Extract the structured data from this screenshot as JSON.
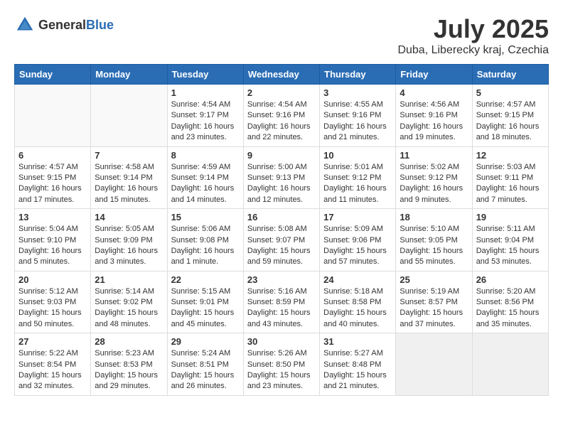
{
  "header": {
    "logo_general": "General",
    "logo_blue": "Blue",
    "title": "July 2025",
    "location": "Duba, Liberecky kraj, Czechia"
  },
  "calendar": {
    "days_of_week": [
      "Sunday",
      "Monday",
      "Tuesday",
      "Wednesday",
      "Thursday",
      "Friday",
      "Saturday"
    ],
    "weeks": [
      [
        {
          "day": "",
          "info": ""
        },
        {
          "day": "",
          "info": ""
        },
        {
          "day": "1",
          "info": "Sunrise: 4:54 AM\nSunset: 9:17 PM\nDaylight: 16 hours\nand 23 minutes."
        },
        {
          "day": "2",
          "info": "Sunrise: 4:54 AM\nSunset: 9:16 PM\nDaylight: 16 hours\nand 22 minutes."
        },
        {
          "day": "3",
          "info": "Sunrise: 4:55 AM\nSunset: 9:16 PM\nDaylight: 16 hours\nand 21 minutes."
        },
        {
          "day": "4",
          "info": "Sunrise: 4:56 AM\nSunset: 9:16 PM\nDaylight: 16 hours\nand 19 minutes."
        },
        {
          "day": "5",
          "info": "Sunrise: 4:57 AM\nSunset: 9:15 PM\nDaylight: 16 hours\nand 18 minutes."
        }
      ],
      [
        {
          "day": "6",
          "info": "Sunrise: 4:57 AM\nSunset: 9:15 PM\nDaylight: 16 hours\nand 17 minutes."
        },
        {
          "day": "7",
          "info": "Sunrise: 4:58 AM\nSunset: 9:14 PM\nDaylight: 16 hours\nand 15 minutes."
        },
        {
          "day": "8",
          "info": "Sunrise: 4:59 AM\nSunset: 9:14 PM\nDaylight: 16 hours\nand 14 minutes."
        },
        {
          "day": "9",
          "info": "Sunrise: 5:00 AM\nSunset: 9:13 PM\nDaylight: 16 hours\nand 12 minutes."
        },
        {
          "day": "10",
          "info": "Sunrise: 5:01 AM\nSunset: 9:12 PM\nDaylight: 16 hours\nand 11 minutes."
        },
        {
          "day": "11",
          "info": "Sunrise: 5:02 AM\nSunset: 9:12 PM\nDaylight: 16 hours\nand 9 minutes."
        },
        {
          "day": "12",
          "info": "Sunrise: 5:03 AM\nSunset: 9:11 PM\nDaylight: 16 hours\nand 7 minutes."
        }
      ],
      [
        {
          "day": "13",
          "info": "Sunrise: 5:04 AM\nSunset: 9:10 PM\nDaylight: 16 hours\nand 5 minutes."
        },
        {
          "day": "14",
          "info": "Sunrise: 5:05 AM\nSunset: 9:09 PM\nDaylight: 16 hours\nand 3 minutes."
        },
        {
          "day": "15",
          "info": "Sunrise: 5:06 AM\nSunset: 9:08 PM\nDaylight: 16 hours\nand 1 minute."
        },
        {
          "day": "16",
          "info": "Sunrise: 5:08 AM\nSunset: 9:07 PM\nDaylight: 15 hours\nand 59 minutes."
        },
        {
          "day": "17",
          "info": "Sunrise: 5:09 AM\nSunset: 9:06 PM\nDaylight: 15 hours\nand 57 minutes."
        },
        {
          "day": "18",
          "info": "Sunrise: 5:10 AM\nSunset: 9:05 PM\nDaylight: 15 hours\nand 55 minutes."
        },
        {
          "day": "19",
          "info": "Sunrise: 5:11 AM\nSunset: 9:04 PM\nDaylight: 15 hours\nand 53 minutes."
        }
      ],
      [
        {
          "day": "20",
          "info": "Sunrise: 5:12 AM\nSunset: 9:03 PM\nDaylight: 15 hours\nand 50 minutes."
        },
        {
          "day": "21",
          "info": "Sunrise: 5:14 AM\nSunset: 9:02 PM\nDaylight: 15 hours\nand 48 minutes."
        },
        {
          "day": "22",
          "info": "Sunrise: 5:15 AM\nSunset: 9:01 PM\nDaylight: 15 hours\nand 45 minutes."
        },
        {
          "day": "23",
          "info": "Sunrise: 5:16 AM\nSunset: 8:59 PM\nDaylight: 15 hours\nand 43 minutes."
        },
        {
          "day": "24",
          "info": "Sunrise: 5:18 AM\nSunset: 8:58 PM\nDaylight: 15 hours\nand 40 minutes."
        },
        {
          "day": "25",
          "info": "Sunrise: 5:19 AM\nSunset: 8:57 PM\nDaylight: 15 hours\nand 37 minutes."
        },
        {
          "day": "26",
          "info": "Sunrise: 5:20 AM\nSunset: 8:56 PM\nDaylight: 15 hours\nand 35 minutes."
        }
      ],
      [
        {
          "day": "27",
          "info": "Sunrise: 5:22 AM\nSunset: 8:54 PM\nDaylight: 15 hours\nand 32 minutes."
        },
        {
          "day": "28",
          "info": "Sunrise: 5:23 AM\nSunset: 8:53 PM\nDaylight: 15 hours\nand 29 minutes."
        },
        {
          "day": "29",
          "info": "Sunrise: 5:24 AM\nSunset: 8:51 PM\nDaylight: 15 hours\nand 26 minutes."
        },
        {
          "day": "30",
          "info": "Sunrise: 5:26 AM\nSunset: 8:50 PM\nDaylight: 15 hours\nand 23 minutes."
        },
        {
          "day": "31",
          "info": "Sunrise: 5:27 AM\nSunset: 8:48 PM\nDaylight: 15 hours\nand 21 minutes."
        },
        {
          "day": "",
          "info": ""
        },
        {
          "day": "",
          "info": ""
        }
      ]
    ]
  }
}
